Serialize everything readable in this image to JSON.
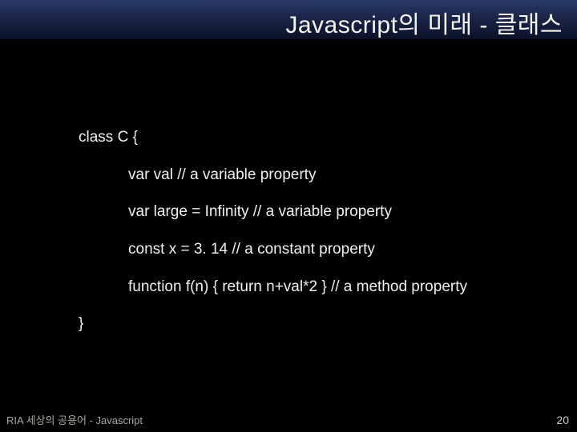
{
  "header": {
    "title": "Javascript의 미래 - 클래스"
  },
  "code": {
    "open": "class C {",
    "line1": "var val // a variable property",
    "line2": "var large = Infinity // a variable property",
    "line3": "const x = 3. 14 // a constant property",
    "line4": "function f(n) { return n+val*2 } // a method property",
    "close": "}"
  },
  "footer": {
    "text": "RIA 세상의 공용어 - Javascript",
    "page": "20"
  }
}
